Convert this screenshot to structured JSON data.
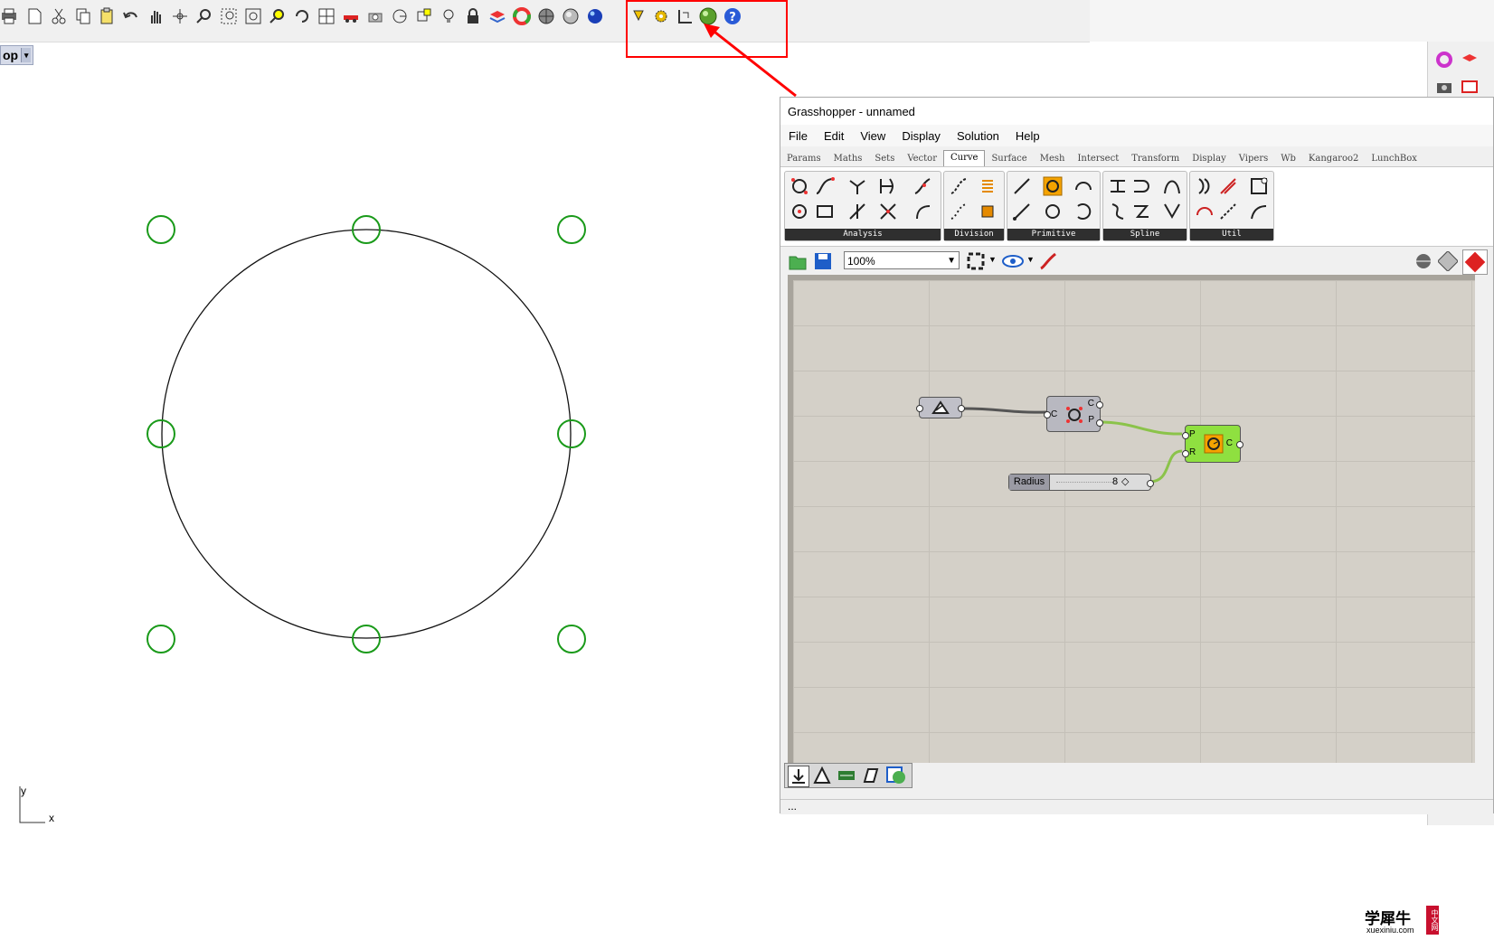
{
  "rhino": {
    "toolbar_icons": [
      "print-icon",
      "new-icon",
      "cut-icon",
      "copy-icon",
      "paste-icon",
      "undo-icon",
      "pan-icon",
      "rotate-view-icon",
      "zoom-icon",
      "zoom-window-icon",
      "zoom-extents-icon",
      "zoom-selected-icon",
      "rotate-icon",
      "four-viewports-icon",
      "car-icon",
      "camera-icon",
      "circle-icon",
      "snap-icon",
      "light-bulb-icon",
      "lock-icon",
      "layers-icon",
      "color-wheel-icon",
      "sphere-gray-icon",
      "sphere-shaded-icon",
      "sphere-blue-icon",
      "pencil-icon",
      "gear-icon",
      "dimension-icon",
      "grasshopper-icon",
      "help-icon"
    ],
    "viewport_label": "op",
    "axis_y": "y",
    "axis_x": "x"
  },
  "grasshopper": {
    "title": "Grasshopper - unnamed",
    "menu": [
      "File",
      "Edit",
      "View",
      "Display",
      "Solution",
      "Help"
    ],
    "tabs": [
      "Params",
      "Maths",
      "Sets",
      "Vector",
      "Curve",
      "Surface",
      "Mesh",
      "Intersect",
      "Transform",
      "Display",
      "Vipers",
      "Wb",
      "Kangaroo2",
      "LunchBox"
    ],
    "active_tab": "Curve",
    "panels": [
      "Analysis",
      "Division",
      "Primitive",
      "Spline",
      "Util"
    ],
    "zoom": "100%",
    "nodes": {
      "input_param_label": "",
      "deconstruct_inputs": [
        "C"
      ],
      "deconstruct_outputs": [
        "C",
        "P"
      ],
      "circle_inputs": [
        "P",
        "R"
      ],
      "circle_outputs": [
        "C"
      ],
      "slider_name": "Radius",
      "slider_value": "8"
    },
    "status": "..."
  },
  "watermark": {
    "cn": "学犀牛",
    "site": "xuexiniu.com",
    "badge": "中文网"
  },
  "colors": {
    "highlight": "#ff0000",
    "point_marker": "#1a9a1a",
    "gh_canvas": "#d4d0c8",
    "wire_green": "#8bc34a"
  }
}
